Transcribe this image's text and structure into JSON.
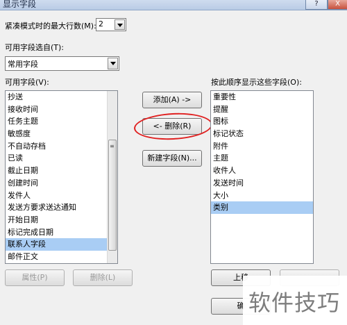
{
  "window": {
    "title": "显示字段",
    "help_label": "?",
    "close_label": "X"
  },
  "compact_rows": {
    "label": "紧凑模式时的最大行数(M):",
    "value": "2"
  },
  "select_from": {
    "label": "可用字段选自(T):",
    "value": "常用字段"
  },
  "available": {
    "label": "可用字段(V):",
    "items": [
      "抄送",
      "接收时间",
      "任务主题",
      "敏感度",
      "不自动存档",
      "已读",
      "截止日期",
      "创建时间",
      "发件人",
      "发送方要求送达通知",
      "开始日期",
      "标记完成日期",
      "联系人字段",
      "邮件正文"
    ],
    "selected_index": 12
  },
  "shown": {
    "label": "按此顺序显示这些字段(O):",
    "items": [
      "重要性",
      "提醒",
      "图标",
      "标记状态",
      "附件",
      "主题",
      "收件人",
      "发送时间",
      "大小",
      "类别"
    ],
    "selected_index": 9
  },
  "buttons": {
    "add": "添加(A) ->",
    "remove": "<- 删除(R)",
    "new_field": "新建字段(N)...",
    "properties": "属性(P)",
    "delete": "删除(L)",
    "move_up": "上移",
    "ok": "确"
  },
  "watermark": "软件技巧"
}
